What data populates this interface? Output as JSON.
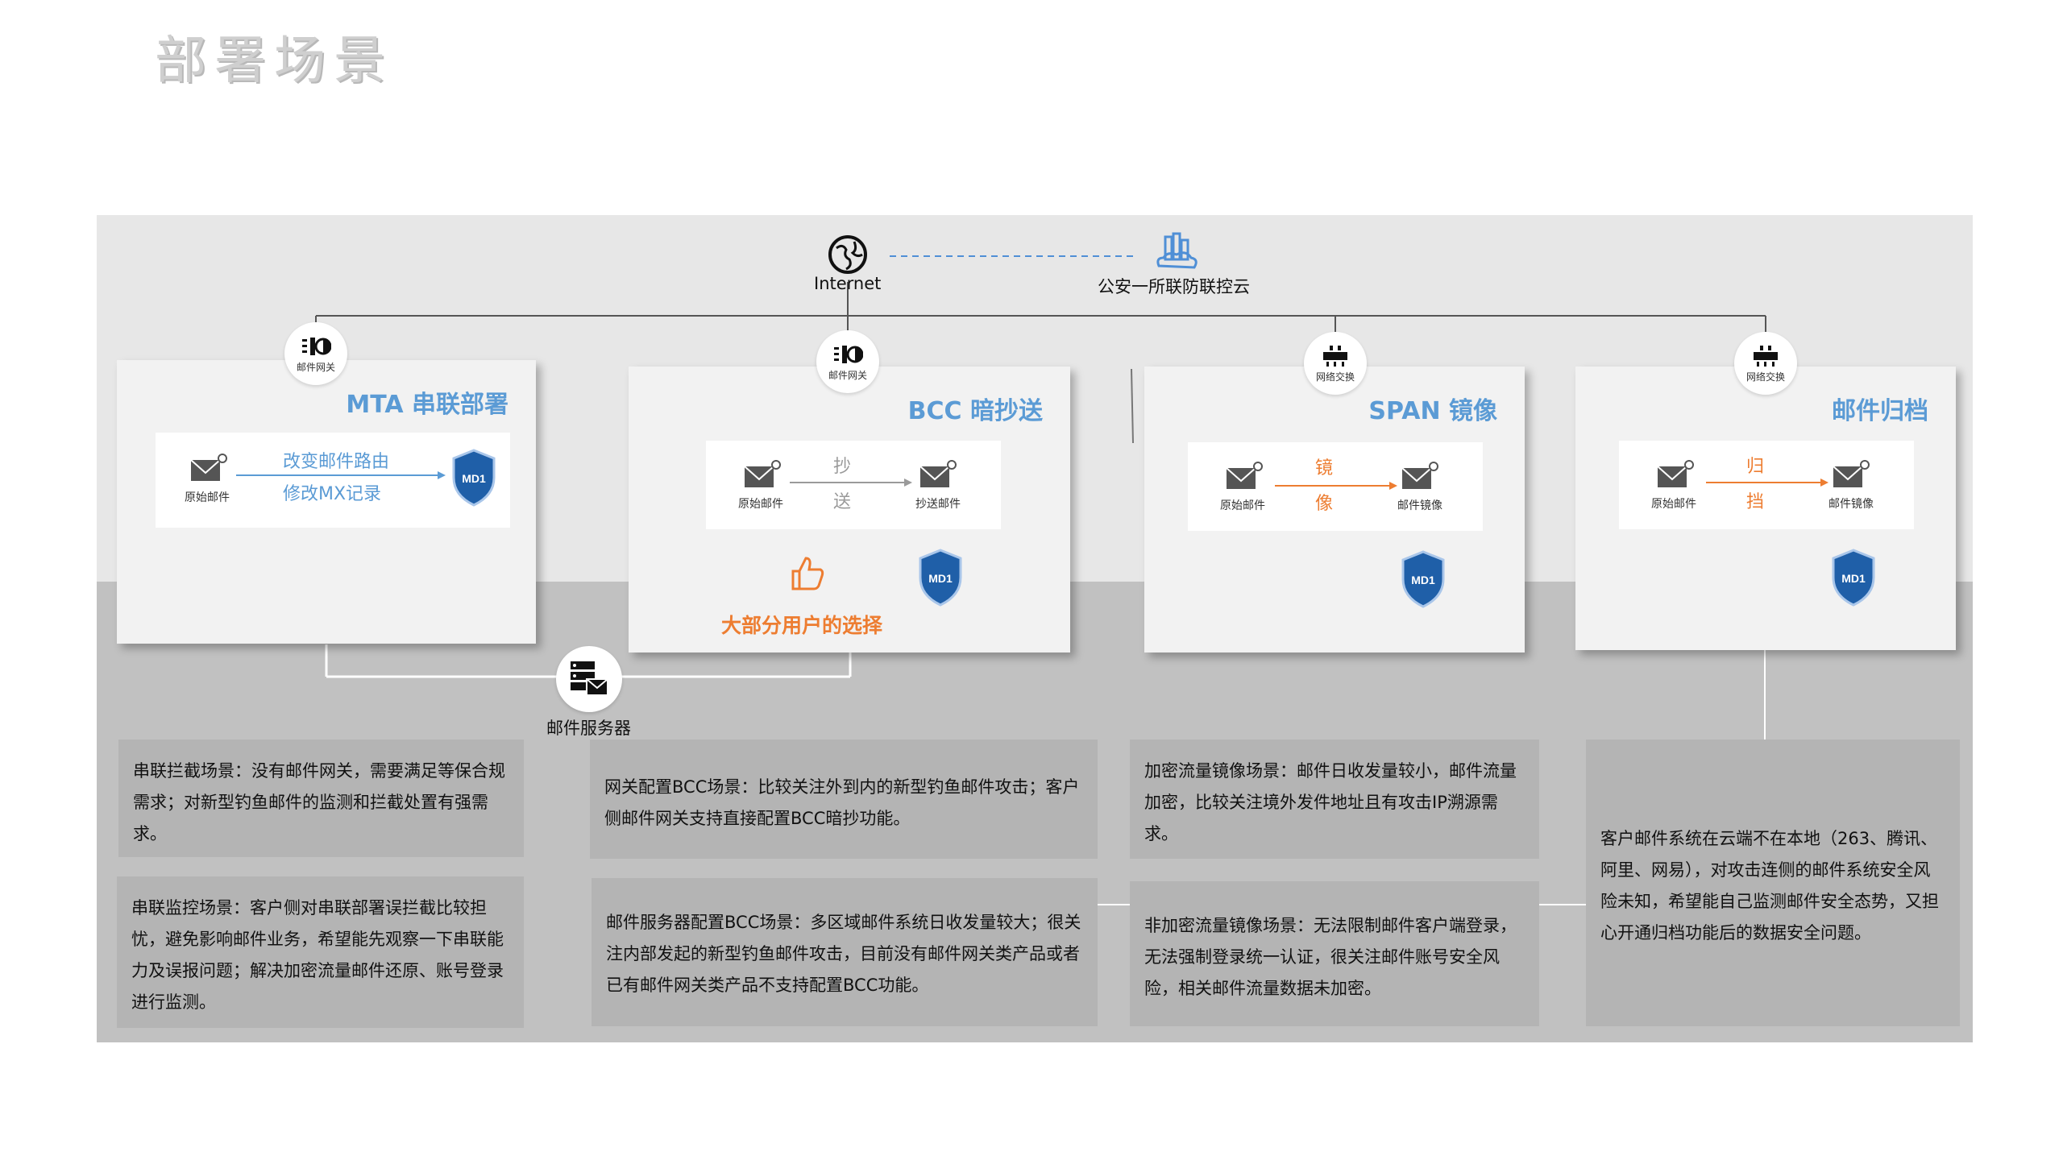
{
  "page": {
    "title": "部署场景"
  },
  "top": {
    "internet_label": "Internet",
    "cloud_label": "公安一所联防联控云"
  },
  "cards": {
    "mta": {
      "title": "MTA 串联部署",
      "device_label": "邮件网关",
      "source_label": "原始邮件",
      "line1": "改变邮件路由",
      "line2": "修改MX记录",
      "shield_text": "MD1"
    },
    "bcc": {
      "title": "BCC 暗抄送",
      "device_label": "邮件网关",
      "source_label": "原始邮件",
      "mid1": "抄",
      "mid2": "送",
      "target_label": "抄送邮件",
      "shield_text": "MD1",
      "choice": "大部分用户的选择"
    },
    "span": {
      "title": "SPAN 镜像",
      "device_label": "网络交换",
      "source_label": "原始邮件",
      "mid1": "镜",
      "mid2": "像",
      "target_label": "邮件镜像",
      "shield_text": "MD1"
    },
    "archive": {
      "title": "邮件归档",
      "device_label": "网络交换",
      "source_label": "原始邮件",
      "mid1": "归",
      "mid2": "挡",
      "target_label": "邮件镜像",
      "shield_text": "MD1"
    }
  },
  "mail_server_label": "邮件服务器",
  "descriptions": {
    "mta_1": "串联拦截场景：没有邮件网关，需要满足等保合规需求；对新型钓鱼邮件的监测和拦截处置有强需求。",
    "mta_2": "串联监控场景：客户侧对串联部署误拦截比较担忧，避免影响邮件业务，希望能先观察一下串联能力及误报问题；解决加密流量邮件还原、账号登录进行监测。",
    "bcc_1": "网关配置BCC场景：比较关注外到内的新型钓鱼邮件攻击；客户侧邮件网关支持直接配置BCC暗抄功能。",
    "bcc_2": "邮件服务器配置BCC场景：多区域邮件系统日收发量较大；很关注内部发起的新型钓鱼邮件攻击，目前没有邮件网关类产品或者已有邮件网关类产品不支持配置BCC功能。",
    "span_1": "加密流量镜像场景：邮件日收发量较小，邮件流量加密，比较关注境外发件地址且有攻击IP溯源需求。",
    "span_2": "非加密流量镜像场景：无法限制邮件客户端登录，无法强制登录统一认证，很关注邮件账号安全风险，相关邮件流量数据未加密。",
    "archive_1": "客户邮件系统在云端不在本地（263、腾讯、阿里、网易），对攻击连侧的邮件系统安全风险未知，希望能自己监测邮件安全态势，又担心开通归档功能后的数据安全问题。"
  },
  "colors": {
    "accent_blue": "#5b9bd5",
    "accent_orange": "#ed7d31",
    "shield_blue": "#1f5fa8"
  }
}
